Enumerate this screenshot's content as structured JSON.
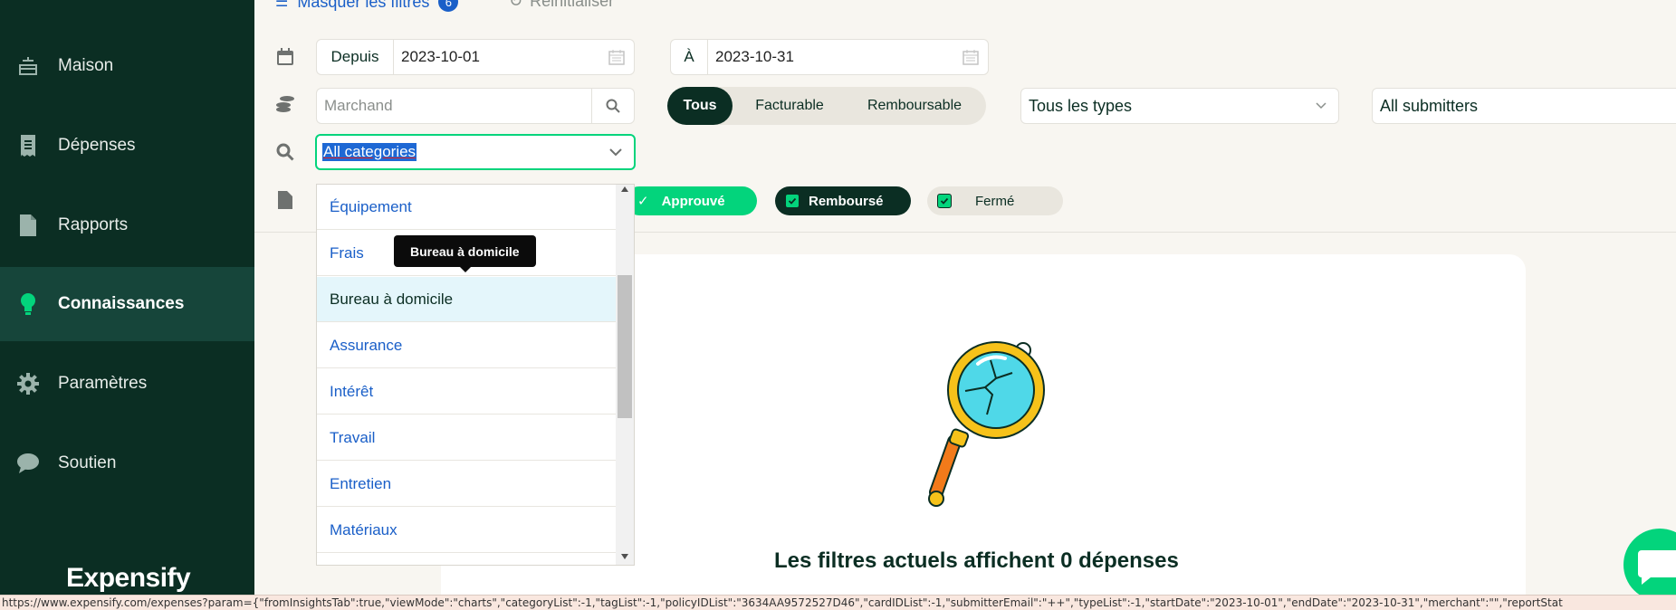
{
  "sidebar": {
    "items": [
      {
        "label": "Maison",
        "icon": "home-icon"
      },
      {
        "label": "Dépenses",
        "icon": "receipt-icon"
      },
      {
        "label": "Rapports",
        "icon": "document-icon"
      },
      {
        "label": "Connaissances",
        "icon": "lightbulb-icon",
        "active": true
      },
      {
        "label": "Paramètres",
        "icon": "gear-icon"
      },
      {
        "label": "Soutien",
        "icon": "chat-bubble-icon"
      }
    ],
    "brand": "Expensify"
  },
  "filters": {
    "hide_filters_label": "Masquer les filtres",
    "hide_filters_count": "6",
    "reset_label": "Réinitialiser",
    "date_from_prefix": "Depuis",
    "date_from": "2023-10-01",
    "date_to_prefix": "À",
    "date_to": "2023-10-31",
    "merchant_placeholder": "Marchand",
    "segments": [
      "Tous",
      "Facturable",
      "Remboursable"
    ],
    "types_select": "Tous les types",
    "submitters_select": "All submitters",
    "category_select": "All categories",
    "statuses": [
      {
        "label": "Approuvé"
      },
      {
        "label": "Remboursé"
      },
      {
        "label": "Fermé"
      }
    ]
  },
  "dropdown": {
    "items": [
      "Équipement",
      "Frais",
      "Bureau à domicile",
      "Assurance",
      "Intérêt",
      "Travail",
      "Entretien",
      "Matériaux"
    ],
    "highlighted": "Bureau à domicile",
    "tooltip": "Bureau à domicile"
  },
  "empty_state": {
    "title": "Les filtres actuels affichent 0 dépenses"
  },
  "status_url": "https://www.expensify.com/expenses?param={\"fromInsightsTab\":true,\"viewMode\":\"charts\",\"categoryList\":-1,\"tagList\":-1,\"policyIDList\":\"3634AA9572527D46\",\"cardIDList\":-1,\"submitterEmail\":\"++\",\"typeList\":-1,\"startDate\":\"2023-10-01\",\"endDate\":\"2023-10-31\",\"merchant\":\"\",\"reportStat"
}
